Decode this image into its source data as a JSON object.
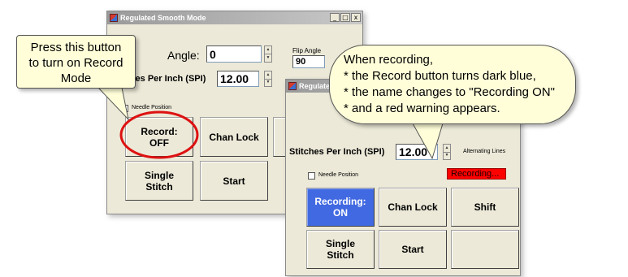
{
  "window_left": {
    "title": "Regulated Smooth Mode",
    "min_glyph": "_",
    "max_glyph": "□",
    "close_glyph": "x",
    "angle_label": "Angle:",
    "angle_value": "0",
    "flip_angle_label": "Flip Angle",
    "flip_angle_value": "90",
    "spi_label": "Stitches Per Inch (SPI)",
    "spi_value": "12.00",
    "needle_position_label": "Needle Position",
    "buttons": {
      "record": "Record:\nOFF",
      "chan_lock": "Chan Lock",
      "single_stitch": "Single\nStitch",
      "start": "Start"
    }
  },
  "window_right": {
    "title": "Regulated Smooth Mode",
    "spi_label": "Stitches Per Inch (SPI)",
    "spi_value": "12.00",
    "alternating_lines_label": "Alternating Lines",
    "needle_position_label": "Needle Position",
    "warning_text": "Recording...",
    "buttons": {
      "recording": "Recording:\nON",
      "chan_lock": "Chan Lock",
      "shift": "Shift",
      "single_stitch": "Single\nStitch",
      "start": "Start",
      "blank": ""
    }
  },
  "callout_left": {
    "lines": [
      "Press this button",
      "to turn on Record",
      "Mode"
    ]
  },
  "callout_right": {
    "lines": [
      "When recording,",
      "* the Record button turns dark blue,",
      "* the name changes to \"Recording ON\"",
      "* and a red warning appears."
    ]
  },
  "colors": {
    "recording_on": "#4169e1",
    "warning": "#ff0000",
    "highlight_ellipse": "#dd1111",
    "callout_bg": "#fffed9"
  }
}
